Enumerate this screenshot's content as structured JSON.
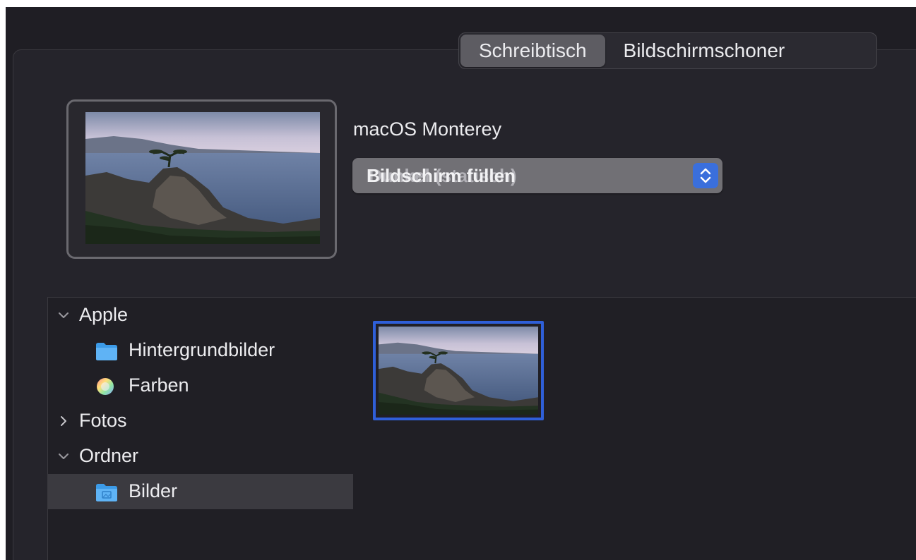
{
  "tabs": {
    "desktop_label": "Schreibtisch",
    "screensaver_label": "Bildschirmschoner"
  },
  "current_wallpaper": {
    "name": "macOS Monterey",
    "mode_selected": "Bildschirm füllen",
    "mode_ghost": "Dunkel (statisch)"
  },
  "sidebar": {
    "apple": {
      "label": "Apple",
      "items": [
        {
          "label": "Hintergrundbilder",
          "icon": "folder-icon"
        },
        {
          "label": "Farben",
          "icon": "color-wheel-icon"
        }
      ]
    },
    "photos": {
      "label": "Fotos"
    },
    "folders": {
      "label": "Ordner",
      "items": [
        {
          "label": "Bilder",
          "icon": "pictures-folder-icon",
          "selected": true
        }
      ]
    }
  },
  "colors": {
    "accent": "#3a6fdc",
    "selection_border": "#2f5fd8",
    "window_bg": "#1f1e24"
  }
}
